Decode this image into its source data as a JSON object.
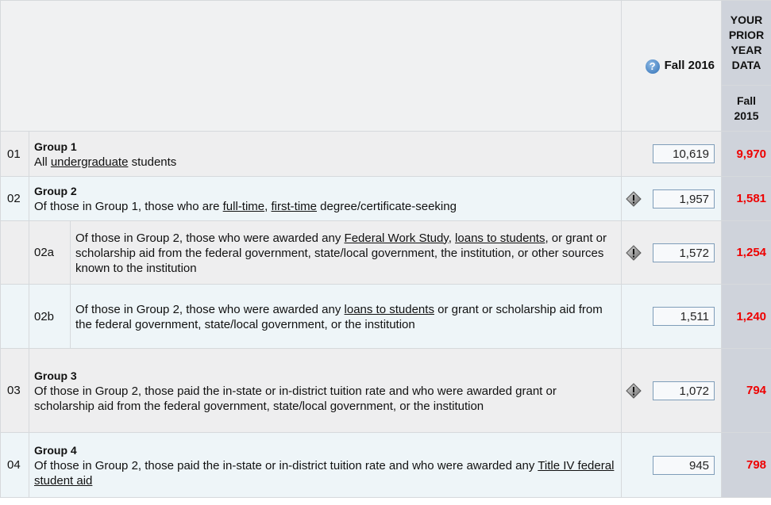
{
  "header": {
    "current_col": "Fall 2016",
    "prior_col_title": "YOUR PRIOR YEAR DATA",
    "prior_col_sub": "Fall 2015"
  },
  "rows": [
    {
      "num": "01",
      "title": "Group 1",
      "desc_pre": "All ",
      "desc_link1": "undergraduate",
      "desc_post": " students",
      "value": "10,619",
      "prior": "9,970"
    },
    {
      "num": "02",
      "title": "Group 2",
      "desc_pre": "Of those in Group 1, those who are ",
      "desc_link1": "full-time",
      "desc_mid": ", ",
      "desc_link2": "first-time",
      "desc_post": " degree/certificate-seeking",
      "value": "1,957",
      "prior": "1,581"
    },
    {
      "num": "02a",
      "desc_pre": "Of those in Group 2, those who were awarded any ",
      "desc_link1": "Federal Work Study",
      "desc_mid": ", ",
      "desc_link2": "loans to students",
      "desc_post": ", or grant or scholarship aid from the federal government, state/local government, the institution, or other sources known to the institution",
      "value": "1,572",
      "prior": "1,254"
    },
    {
      "num": "02b",
      "desc_pre": "Of those in Group 2, those who were awarded any ",
      "desc_link1": "loans to students",
      "desc_post": " or grant or scholarship aid from the federal government, state/local government, or the institution",
      "value": "1,511",
      "prior": "1,240"
    },
    {
      "num": "03",
      "title": "Group 3",
      "desc_pre": "Of those in Group 2, those paid the in-state or in-district tuition rate and who were awarded grant or scholarship aid from the federal government, state/local government, or the institution",
      "value": "1,072",
      "prior": "794"
    },
    {
      "num": "04",
      "title": "Group 4",
      "desc_pre": "Of those in Group 2, those paid the in-state or in-district tuition rate and who were awarded any ",
      "desc_link1": "Title IV federal student aid",
      "value": "945",
      "prior": "798"
    }
  ],
  "icons": {
    "help": "help-icon",
    "warning": "warning-icon"
  },
  "colors": {
    "prior_value": "#ee0000",
    "prior_column_bg": "#cfd3db"
  }
}
